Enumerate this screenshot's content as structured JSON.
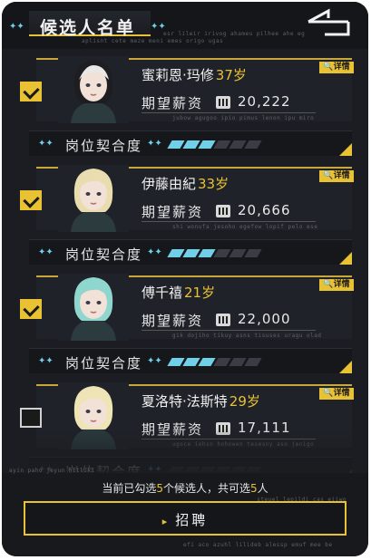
{
  "header": {
    "title": "候选人名单",
    "decor_text_1": "aplisnt cete meze meni emes origo ugas",
    "decor_text_2": "esr lileir irivog ahameu pilhee ahe eg",
    "icon": "back-arrow-icon"
  },
  "candidates": [
    {
      "name": "蜜莉恩·玛修",
      "age": "37岁",
      "salary_label": "期望薪资",
      "salary": "20,222",
      "detail_label": "详情",
      "match_label": "岗位契合度",
      "match_level": 3,
      "match_max": 6,
      "checked": true,
      "sub_text": "jubow agugoo ipio pimus lenon ipu miro",
      "hair_color": "#1e1e22",
      "hair_accent": "#e8e8e8"
    },
    {
      "name": "伊藤由紀",
      "age": "33岁",
      "salary_label": "期望薪资",
      "salary": "20,666",
      "detail_label": "详情",
      "match_label": "岗位契合度",
      "match_level": 3,
      "match_max": 6,
      "checked": true,
      "sub_text": "shi wonufa jesoho egefow lopif pelo ese",
      "hair_color": "#e9dcae",
      "hair_accent": "#e9dcae"
    },
    {
      "name": "傅千禧",
      "age": "21岁",
      "salary_label": "期望薪资",
      "salary": "22,000",
      "detail_label": "详情",
      "match_label": "岗位契合度",
      "match_level": 3,
      "match_max": 6,
      "checked": true,
      "sub_text": "gik dojiho tikuy asns tisuses uragu olad",
      "hair_color": "#8fd6cf",
      "hair_accent": "#8fd6cf"
    },
    {
      "name": "夏洛特·法斯特",
      "age": "29岁",
      "salary_label": "期望薪资",
      "salary": "17,111",
      "detail_label": "详情",
      "match_label": "岗位契合度",
      "match_level": 0,
      "match_max": 6,
      "checked": false,
      "sub_text": "ugoce iehsn hohowen tesesny aso jenigo",
      "hair_color": "#efe4b6",
      "hair_accent": "#efe4b6"
    }
  ],
  "footer": {
    "info_prefix": "当前已勾选",
    "selected_count": "5",
    "info_mid": "个候选人，共可选",
    "max_count": "5",
    "info_suffix": "人",
    "hire_label": "招聘",
    "decor_text_3": "ayin paho jeyun hitliki",
    "decor_text_4": "steuel lepildi cas eiiwo",
    "decor_text_5": "efi aco azuhl lilideb alessp emuf mee be"
  },
  "colors": {
    "accent": "#e8c233",
    "match": "#6fd0e8"
  }
}
